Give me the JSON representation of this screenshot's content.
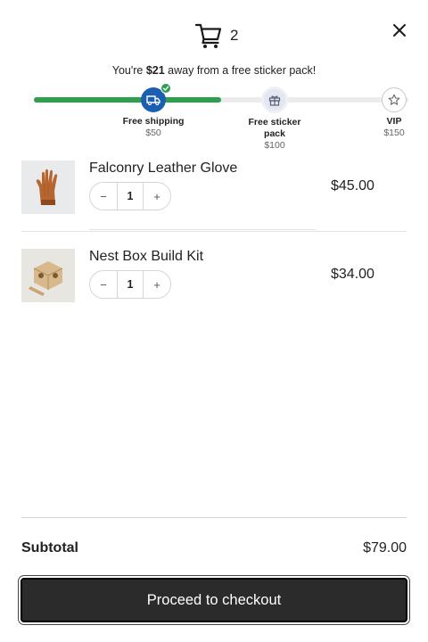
{
  "header": {
    "cart_icon": "shopping-cart-icon",
    "cart_count": "2",
    "close_icon": "close-icon"
  },
  "progress": {
    "message_prefix": "You're ",
    "message_amount": "$21",
    "message_suffix": " away from a free sticker pack!",
    "fill_fraction": 0.5,
    "milestones": [
      {
        "label": "Free shipping",
        "amount": "$50",
        "icon": "truck-icon",
        "state": "achieved"
      },
      {
        "label": "Free sticker pack",
        "amount": "$100",
        "icon": "gift-icon",
        "state": "next"
      },
      {
        "label": "VIP",
        "amount": "$150",
        "icon": "star-icon",
        "state": "locked"
      }
    ]
  },
  "items": [
    {
      "title": "Falconry Leather Glove",
      "quantity": "1",
      "price": "$45.00",
      "minus": "−",
      "plus": "+"
    },
    {
      "title": "Nest Box Build Kit",
      "quantity": "1",
      "price": "$34.00",
      "minus": "−",
      "plus": "+"
    }
  ],
  "summary": {
    "subtotal_label": "Subtotal",
    "subtotal_value": "$79.00",
    "checkout_label": "Proceed to checkout"
  },
  "colors": {
    "progress_fill": "#2e9e4f",
    "milestone_achieved": "#1c5fb0",
    "checkout_button": "#2b2b2b"
  }
}
